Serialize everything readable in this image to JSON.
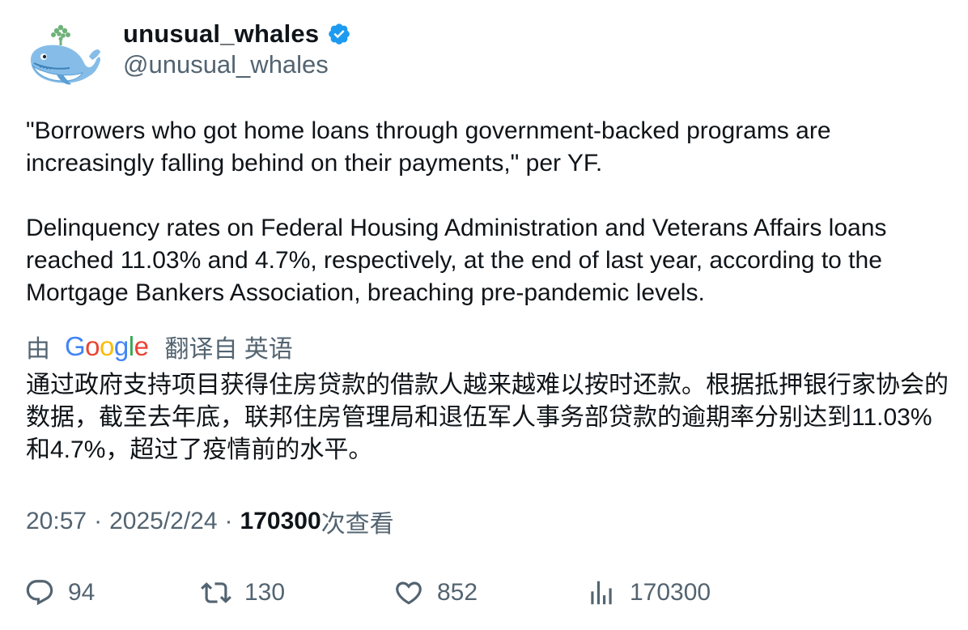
{
  "author": {
    "display_name": "unusual_whales",
    "handle": "@unusual_whales",
    "verified": true,
    "avatar_icon": "whale-icon"
  },
  "tweet": {
    "paragraphs": [
      "\"Borrowers who got home loans through government-backed programs are increasingly falling behind on their payments,\" per YF.",
      "Delinquency rates on Federal Housing Administration and Veterans Affairs loans reached 11.03% and 4.7%, respectively, at the end of last year, according to the Mortgage Bankers Association, breaching pre-pandemic levels."
    ]
  },
  "translation": {
    "by_label": "由",
    "provider": "Google",
    "from_label": "翻译自 英语",
    "text": "通过政府支持项目获得住房贷款的借款人越来越难以按时还款。根据抵押银行家协会的数据，截至去年底，联邦住房管理局和退伍军人事务部贷款的逾期率分别达到11.03%和4.7%，超过了疫情前的水平。"
  },
  "meta": {
    "time": "20:57",
    "date": "2025/2/24",
    "separator": "·",
    "views_count": "170300",
    "views_label": "次查看"
  },
  "actions": {
    "reply_count": "94",
    "retweet_count": "130",
    "like_count": "852",
    "views_count": "170300"
  },
  "colors": {
    "text_primary": "#0f1419",
    "text_secondary": "#536471",
    "verified_blue": "#1d9bf0",
    "avatar_whale": "#7fb8e6"
  }
}
